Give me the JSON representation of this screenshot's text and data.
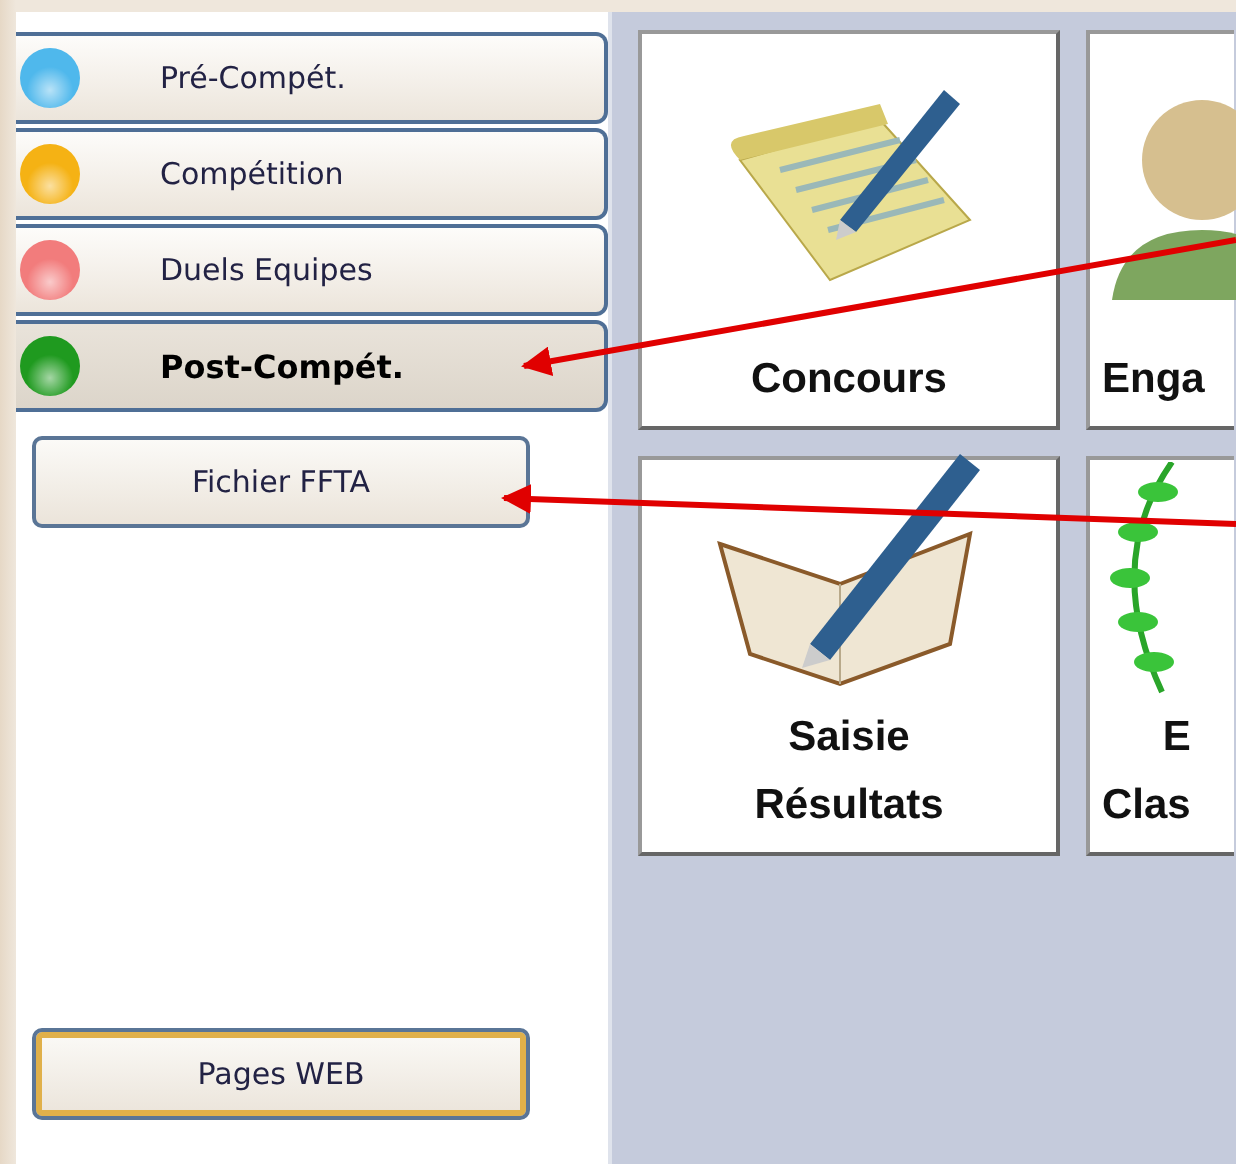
{
  "nav_items": [
    {
      "label": "Pré-Compét.",
      "color": "#4fb8ec",
      "selected": false
    },
    {
      "label": "Compétition",
      "color": "#f5b214",
      "selected": false
    },
    {
      "label": "Duels Equipes",
      "color": "#f27c7c",
      "selected": false
    },
    {
      "label": "Post-Compét.",
      "color": "#1f9a1f",
      "selected": true
    }
  ],
  "buttons": [
    {
      "label": "Fichier FFTA",
      "default": false
    },
    {
      "label": "Pages WEB",
      "default": true
    }
  ],
  "tiles": [
    {
      "label": "Concours",
      "kind": "notepad"
    },
    {
      "label": "Enga",
      "kind": "person"
    },
    {
      "label": "Saisie\nRésultats",
      "kind": "book"
    },
    {
      "label": "E\nClas",
      "kind": "laurel"
    }
  ],
  "annotations": [
    {
      "kind": "arrow"
    },
    {
      "kind": "arrow"
    }
  ]
}
